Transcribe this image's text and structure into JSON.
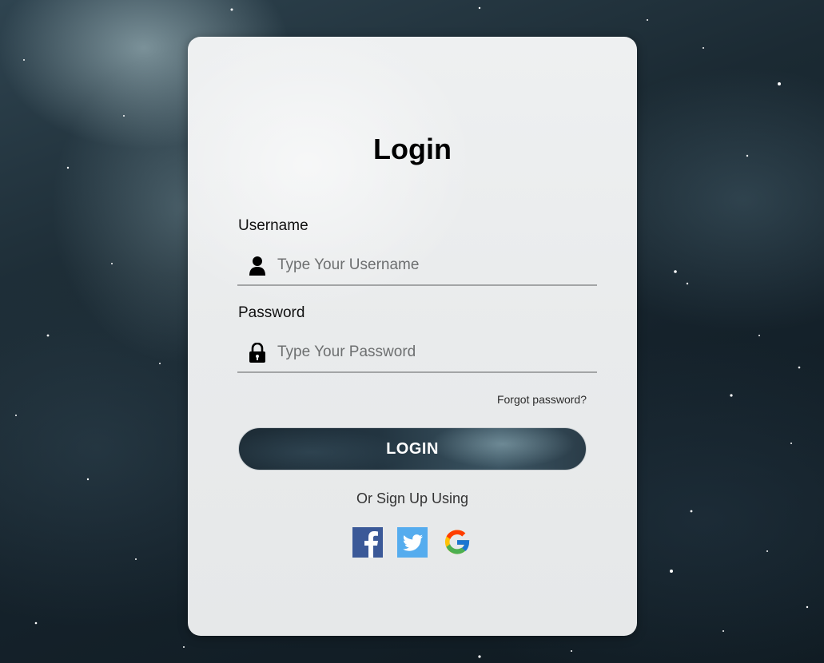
{
  "login_form": {
    "title": "Login",
    "username": {
      "label": "Username",
      "placeholder": "Type Your Username",
      "value": ""
    },
    "password": {
      "label": "Password",
      "placeholder": "Type Your Password",
      "value": ""
    },
    "forgot_password": "Forgot password?",
    "login_button": "LOGIN",
    "signup_prompt": "Or Sign Up Using",
    "social_providers": [
      {
        "name": "facebook",
        "icon": "facebook-icon",
        "color": "#3b5998"
      },
      {
        "name": "twitter",
        "icon": "twitter-icon",
        "color": "#55acee"
      },
      {
        "name": "google",
        "icon": "google-icon",
        "color": "#4285f4"
      }
    ]
  },
  "theme": {
    "card_background": "#eceeef",
    "button_gradient_dark": "#1d2c36",
    "button_gradient_light": "#3c5563",
    "underline": "#a3a5a6"
  }
}
